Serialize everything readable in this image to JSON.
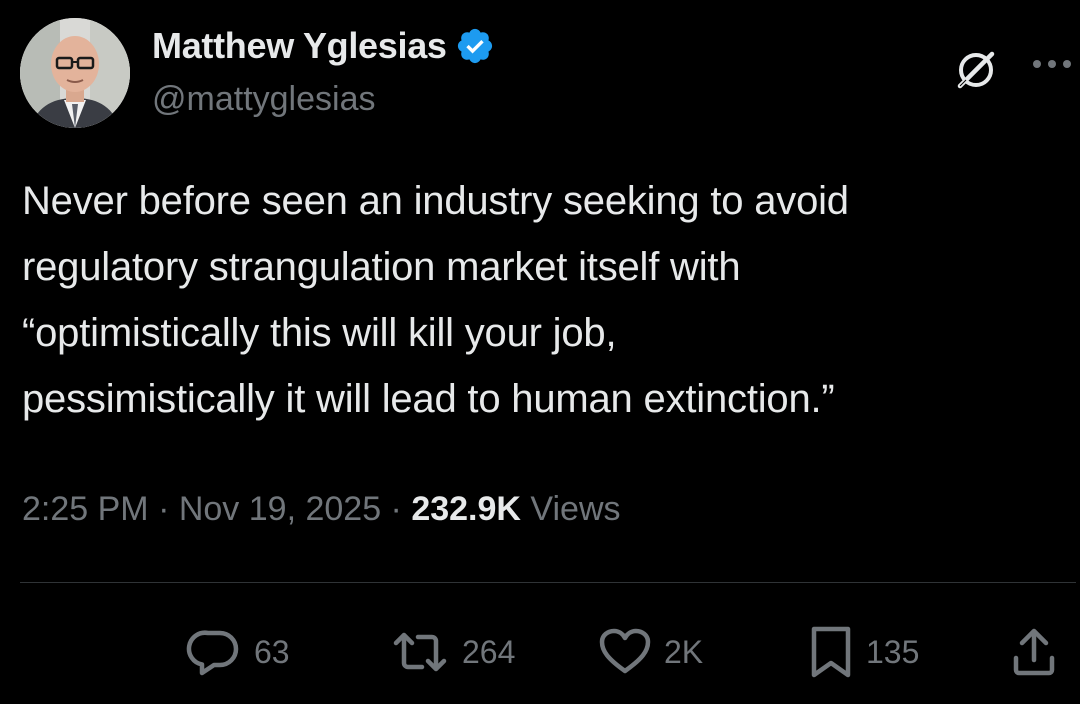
{
  "author": {
    "display_name": "Matthew Yglesias",
    "handle": "@mattyglesias",
    "verified": true
  },
  "tweet": {
    "text_lines": [
      "Never before seen an industry seeking to avoid",
      "regulatory strangulation market itself with",
      "“optimistically this will kill your job,",
      "pessimistically it will lead to human extinction.”"
    ]
  },
  "meta": {
    "time": "2:25 PM",
    "separator": " · ",
    "date": "Nov 19, 2025",
    "views_count": "232.9K",
    "views_label": "Views"
  },
  "actions": {
    "replies": "63",
    "reposts": "264",
    "likes": "2K",
    "bookmarks": "135"
  },
  "icons": {
    "header_right": [
      "grok-icon",
      "more-icon"
    ],
    "actions": [
      "reply-icon",
      "repost-icon",
      "like-icon",
      "bookmark-icon",
      "share-icon"
    ]
  },
  "colors": {
    "background": "#000000",
    "text_primary": "#e7e9ea",
    "text_secondary": "#71767b",
    "verified_blue": "#1d9bf0",
    "divider": "#2f3336"
  }
}
